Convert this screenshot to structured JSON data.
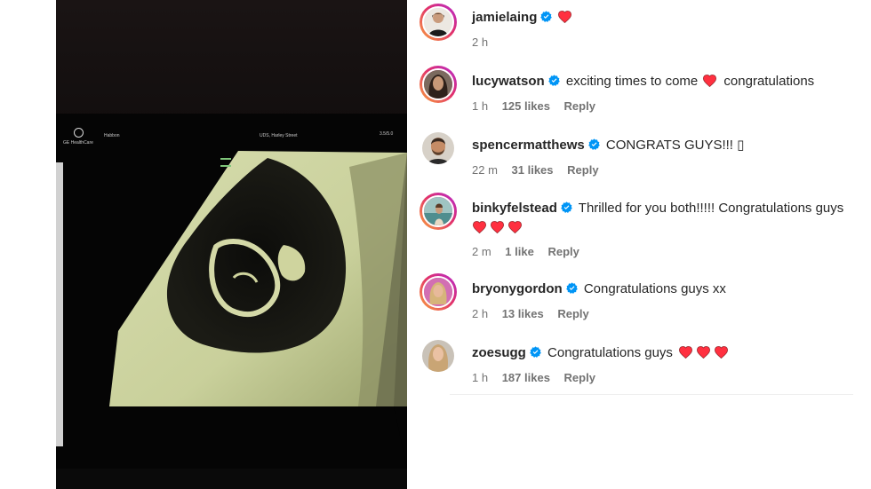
{
  "photo": {
    "monitor_brand": "GE HealthCare",
    "monitor_patient": "Habbon",
    "monitor_clinic": "UDS, Harley Street",
    "monitor_freq": "3.5/5.0"
  },
  "colors": {
    "verified": "#0095f6",
    "heart": "#ff3040",
    "meta": "#737373"
  },
  "comments": [
    {
      "username": "jamielaing",
      "text": "",
      "hearts": 1,
      "time": "2 h",
      "likes": "",
      "reply": "",
      "avatar_icon": "avatar-man-black-shirt",
      "story": true
    },
    {
      "username": "lucywatson",
      "text": "exciting times to come",
      "text_after": "congratulations",
      "hearts_inline": 1,
      "time": "1 h",
      "likes": "125 likes",
      "reply": "Reply",
      "avatar_icon": "avatar-woman-dark-hair",
      "story": true
    },
    {
      "username": "spencermatthews",
      "text": "CONGRATS GUYS!!! ▯",
      "time": "22 m",
      "likes": "31 likes",
      "reply": "Reply",
      "avatar_icon": "avatar-man-beard",
      "story": false
    },
    {
      "username": "binkyfelstead",
      "text": "Thrilled for you both!!!!! Congratulations guys",
      "hearts_below": 3,
      "time": "2 m",
      "likes": "1 like",
      "reply": "Reply",
      "avatar_icon": "avatar-woman-beach",
      "story": true
    },
    {
      "username": "bryonygordon",
      "text": "Congratulations guys xx",
      "time": "2 h",
      "likes": "13 likes",
      "reply": "Reply",
      "avatar_icon": "avatar-woman-blonde",
      "story": true
    },
    {
      "username": "zoesugg",
      "text": "Congratulations guys",
      "hearts": 3,
      "time": "1 h",
      "likes": "187 likes",
      "reply": "Reply",
      "avatar_icon": "avatar-woman-light-hair",
      "story": false
    }
  ]
}
